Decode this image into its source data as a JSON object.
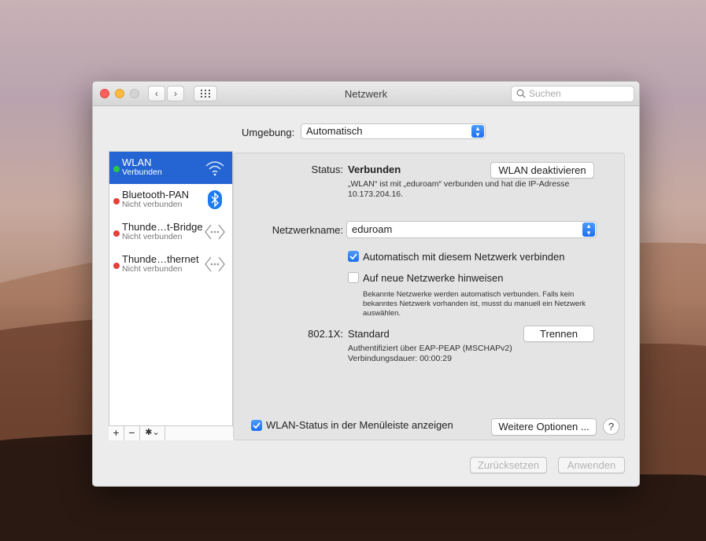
{
  "window": {
    "title": "Netzwerk",
    "nav_back": "‹",
    "nav_forward": "›",
    "search_placeholder": "Suchen"
  },
  "location": {
    "label": "Umgebung:",
    "value": "Automatisch"
  },
  "services": [
    {
      "name": "WLAN",
      "status": "Verbunden",
      "dot_color": "#28c840",
      "icon": "wifi-icon",
      "selected": true
    },
    {
      "name": "Bluetooth-PAN",
      "status": "Nicht verbunden",
      "dot_color": "#e5403a",
      "icon": "bluetooth-icon",
      "selected": false
    },
    {
      "name": "Thunde…t-Bridge",
      "status": "Nicht verbunden",
      "dot_color": "#e5403a",
      "icon": "ethernet-icon",
      "selected": false
    },
    {
      "name": "Thunde…thernet",
      "status": "Nicht verbunden",
      "dot_color": "#e5403a",
      "icon": "ethernet-icon",
      "selected": false
    }
  ],
  "sidebar_tools": {
    "add": "+",
    "remove": "−",
    "gear": "✱⌄"
  },
  "detail": {
    "status_label": "Status:",
    "status_value": "Verbunden",
    "deactivate_button": "WLAN deaktivieren",
    "status_desc_line1": "„WLAN“ ist mit „eduroam“ verbunden und hat die IP-Adresse",
    "status_desc_line2": "10.173.204.16.",
    "network_name_label": "Netzwerkname:",
    "network_name_value": "eduroam",
    "auto_join_label": "Automatisch mit diesem Netzwerk verbinden",
    "auto_join_checked": true,
    "ask_new_label": "Auf neue Netzwerke hinweisen",
    "ask_new_checked": false,
    "ask_new_desc_line1": "Bekannte Netzwerke werden automatisch verbunden. Falls kein",
    "ask_new_desc_line2": "bekanntes Netzwerk vorhanden ist, musst du manuell ein Netzwerk",
    "ask_new_desc_line3": "auswählen.",
    "dot1x_label": "802.1X:",
    "dot1x_value": "Standard",
    "disconnect_button": "Trennen",
    "auth_line1": "Authentifiziert über EAP-PEAP (MSCHAPv2)",
    "auth_line2": "Verbindungsdauer: 00:00:29"
  },
  "footer": {
    "menubar_label": "WLAN-Status in der Menüleiste anzeigen",
    "menubar_checked": true,
    "advanced_button": "Weitere Optionen ...",
    "help": "?",
    "revert_button": "Zurücksetzen",
    "apply_button": "Anwenden"
  },
  "colors": {
    "selection_blue": "#2465d3",
    "accent_blue": "#1b6ff2",
    "connected_green": "#28c840",
    "disconnected_red": "#e5403a"
  }
}
